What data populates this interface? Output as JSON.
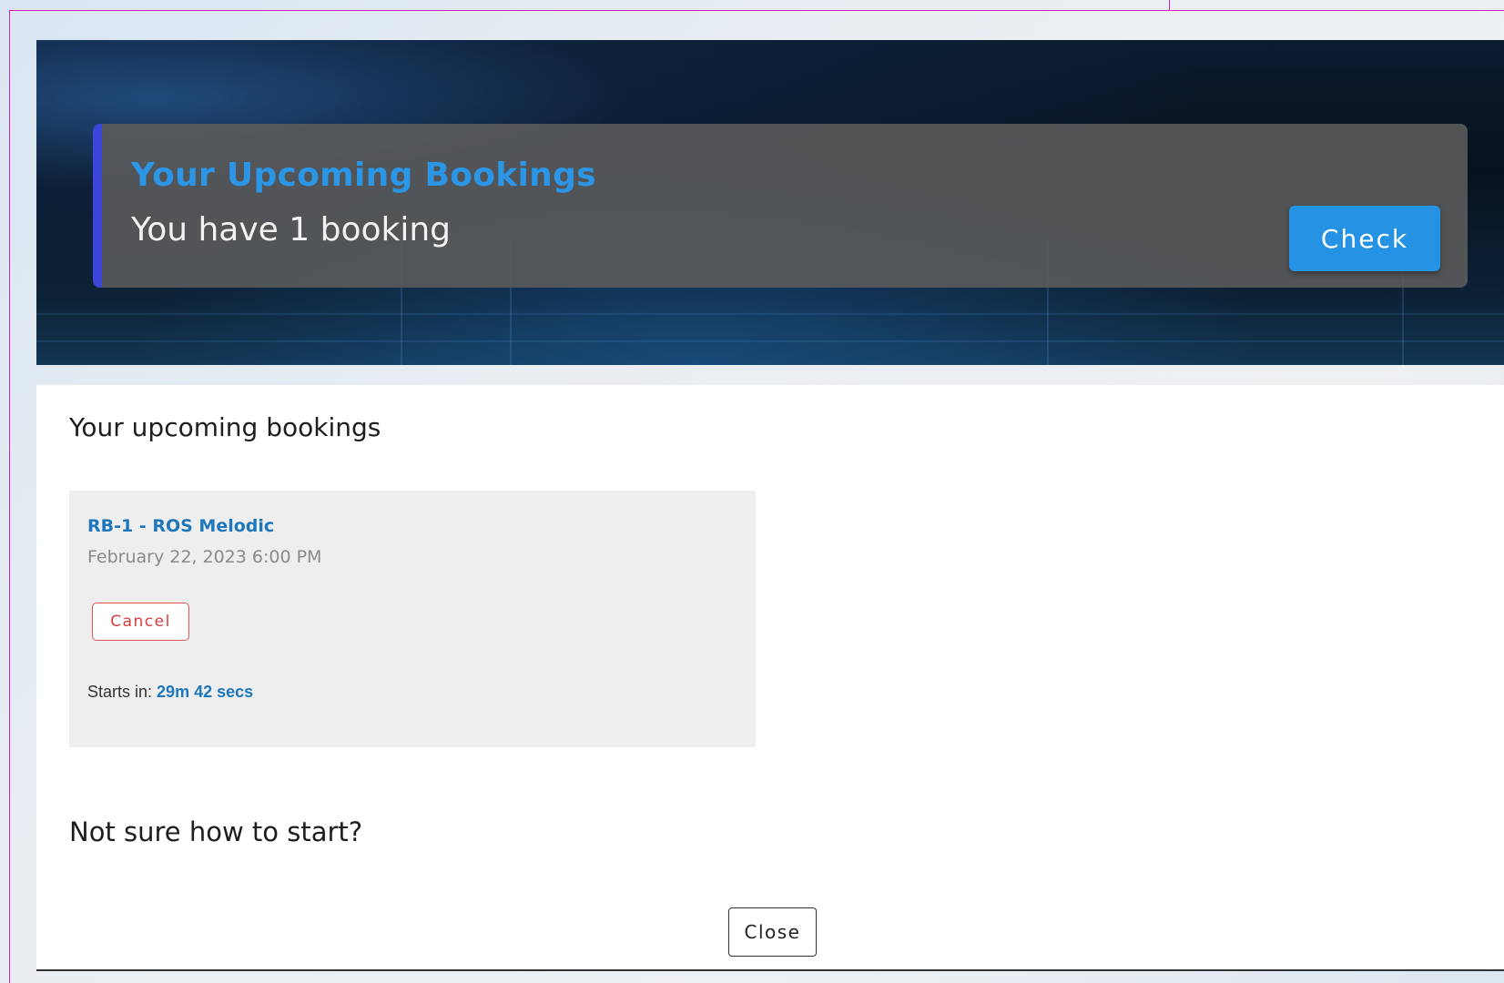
{
  "banner": {
    "title": "Your Upcoming Bookings",
    "subtitle": "You have 1 booking",
    "check_label": "Check",
    "accent_color": "#2b95e6",
    "bar_color": "#3c46d8"
  },
  "modal": {
    "heading": "Your upcoming bookings",
    "booking": {
      "name": "RB-1 - ROS Melodic",
      "date": "February 22, 2023 6:00 PM",
      "cancel_label": "Cancel",
      "starts_label": "Starts in:",
      "starts_value": "29m 42 secs"
    },
    "help_heading": "Not sure how to start?",
    "close_label": "Close"
  }
}
